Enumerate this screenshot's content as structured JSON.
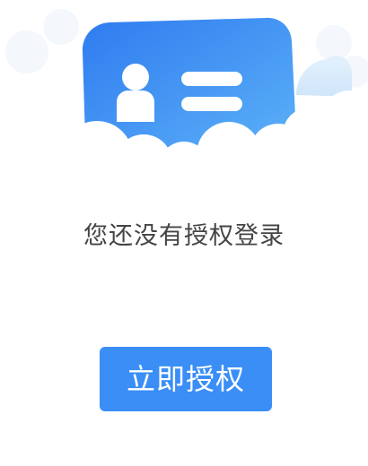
{
  "colors": {
    "accent": "#3a8ef6",
    "card_top": "#2f7bf0",
    "card_bottom": "#5cb2f7",
    "text": "#444444",
    "button_text": "#ffffff"
  },
  "illustration": {
    "icon": "id-card-icon"
  },
  "message": "您还没有授权登录",
  "button": {
    "label": "立即授权"
  }
}
